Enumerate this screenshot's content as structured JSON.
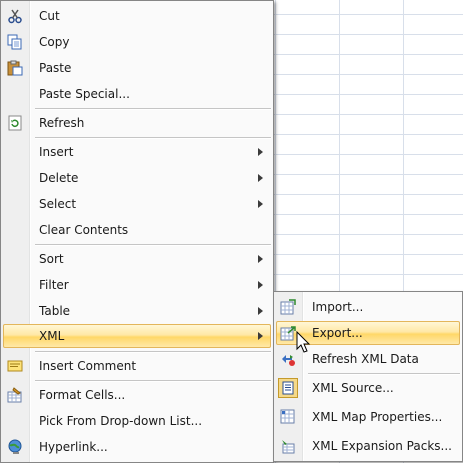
{
  "context_menu": {
    "items": [
      {
        "label": "Cut",
        "icon": "scissors-icon"
      },
      {
        "label": "Copy",
        "icon": "copy-icon"
      },
      {
        "label": "Paste",
        "icon": "paste-icon"
      },
      {
        "label": "Paste Special..."
      },
      {
        "label": "Refresh",
        "icon": "refresh-icon"
      },
      {
        "label": "Insert"
      },
      {
        "label": "Delete"
      },
      {
        "label": "Select"
      },
      {
        "label": "Clear Contents"
      },
      {
        "label": "Sort"
      },
      {
        "label": "Filter"
      },
      {
        "label": "Table"
      },
      {
        "label": "XML"
      },
      {
        "label": "Insert Comment",
        "icon": "insert-comment-icon"
      },
      {
        "label": "Format Cells...",
        "icon": "format-cells-icon"
      },
      {
        "label": "Pick From Drop-down List..."
      },
      {
        "label": "Hyperlink...",
        "icon": "hyperlink-icon"
      }
    ]
  },
  "xml_submenu": {
    "items": [
      {
        "label": "Import...",
        "icon": "xml-import-icon"
      },
      {
        "label": "Export...",
        "icon": "xml-export-icon"
      },
      {
        "label": "Refresh XML Data",
        "icon": "refresh-xml-icon"
      },
      {
        "label": "XML Source...",
        "icon": "xml-source-icon"
      },
      {
        "label": "XML Map Properties...",
        "icon": "xml-map-properties-icon"
      },
      {
        "label": "XML Expansion Packs...",
        "icon": "xml-expansion-packs-icon"
      }
    ]
  },
  "colors": {
    "highlight_top": "#fff7d6",
    "highlight_bottom": "#ffd768",
    "highlight_border": "#e3b65b",
    "menu_bg": "#fafafa",
    "gutter_bg": "#efefef"
  }
}
